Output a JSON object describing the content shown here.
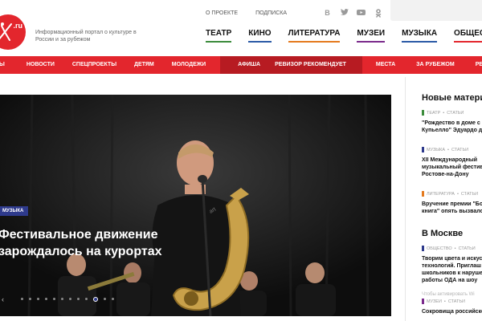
{
  "header": {
    "logo_text": ".ru",
    "tagline": "Информационный портал о культуре в России и за рубежом",
    "toplinks": [
      "О ПРОЕКТЕ",
      "ПОДПИСКА"
    ],
    "social_icons": [
      "vk-icon",
      "twitter-icon",
      "youtube-icon",
      "odnoklassniki-icon",
      "telegram-icon"
    ],
    "main_nav": [
      "ТЕАТР",
      "КИНО",
      "ЛИТЕРАТУРА",
      "МУЗЕИ",
      "МУЗЫКА",
      "ОБЩЕСТВО"
    ]
  },
  "red_nav": {
    "items": [
      "Ы",
      "НОВОСТИ",
      "СПЕЦПРОЕКТЫ",
      "ДЕТЯМ",
      "МОЛОДЕЖИ",
      "АФИША",
      "РЕВИЗОР РЕКОМЕНДУЕТ",
      "МЕСТА",
      "ЗА РУБЕЖОМ",
      "РЕКЛАМА НА ПОРТАЛ"
    ]
  },
  "hero": {
    "badge": "МУЗЫКА",
    "title": "Фестивальное движение зарождалось на курортах",
    "slide_count": 12,
    "active_slide": 9
  },
  "sidebar": {
    "news_title": "Новые материа",
    "news": [
      {
        "category": "ТЕАТР",
        "type": "СТАТЬИ",
        "color": "#3c8c3c",
        "title": "\"Рождество в доме с\nКупьелло\" Эдуардо д"
      },
      {
        "category": "МУЗЫКА",
        "type": "СТАТЬИ",
        "color": "#2e3a8c",
        "title": "XII Международный\nмузыкальный фестив\nРостове-на-Дону"
      },
      {
        "category": "ЛИТЕРАТУРА",
        "type": "СТАТЬИ",
        "color": "#e47a1e",
        "title": "Вручение премии \"Бо\nкнига\" опять вызвало"
      }
    ],
    "moscow_title": "В Москве",
    "moscow": [
      {
        "category": "ОБЩЕСТВО",
        "type": "СТАТЬИ",
        "color": "#2e3a8c",
        "title": "Творим цвета и искусс\nтехнологий. Приглаш\nшкольников к наруше\nработы ОДА на шоу"
      },
      {
        "category": "МУЗЕИ",
        "type": "СТАТЬИ",
        "color": "#7b2a8c",
        "title": "Сокровища российско"
      }
    ],
    "watermark": "Чтобы активировать Wi"
  }
}
